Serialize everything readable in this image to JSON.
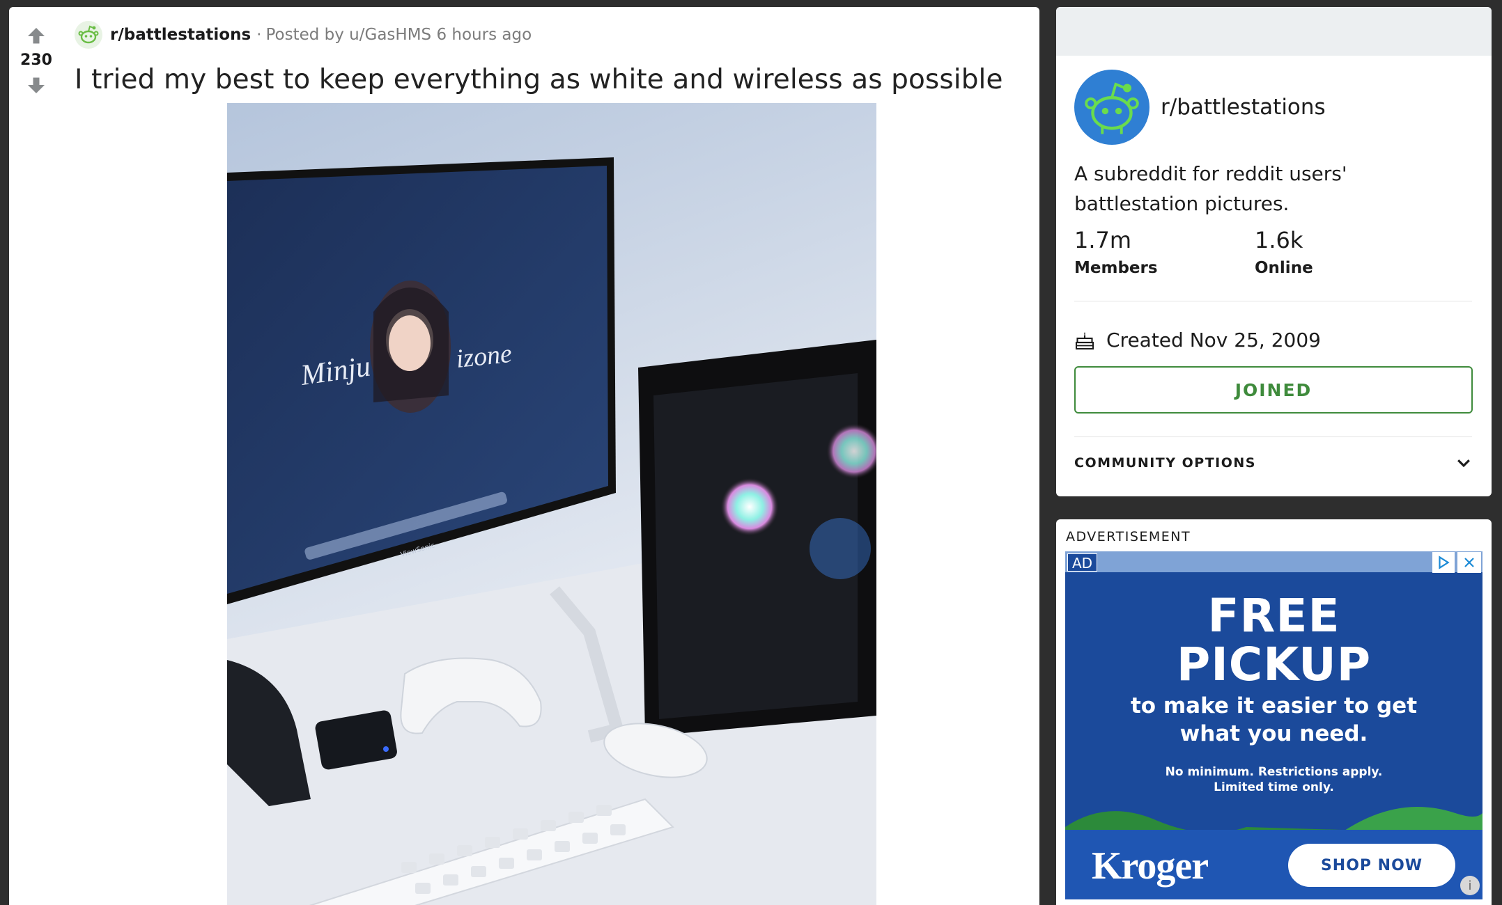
{
  "post": {
    "vote_count": "230",
    "subreddit": "r/battlestations",
    "separator": "·",
    "posted_by": "Posted by u/GasHMS",
    "time_ago": "6 hours ago",
    "title": "I tried my best to keep everything as white and wireless as possible",
    "image": {
      "monitor_wallpaper_left": "Minju",
      "monitor_wallpaper_right": "izone",
      "monitor_brand": "ViewSonic"
    }
  },
  "sidebar": {
    "community_name": "r/battlestations",
    "description": "A subreddit for reddit users' battlestation pictures.",
    "members_count": "1.7m",
    "members_label": "Members",
    "online_count": "1.6k",
    "online_label": "Online",
    "created": "Created Nov 25, 2009",
    "joined_button": "JOINED",
    "community_options": "COMMUNITY OPTIONS"
  },
  "ad": {
    "label": "ADVERTISEMENT",
    "badge": "AD",
    "headline_line1": "FREE",
    "headline_line2": "PICKUP",
    "sub_line1": "to make it easier to get",
    "sub_line2": "what you need.",
    "fine_line1": "No minimum. Restrictions apply.",
    "fine_line2": "Limited time only.",
    "brand": "Kroger",
    "cta": "SHOP NOW",
    "info": "i"
  },
  "colors": {
    "join_green": "#3f8b3c",
    "community_blue": "#2f7fd3",
    "ad_blue": "#1b4a9b",
    "background": "#2e2e2e"
  },
  "icons": [
    "upvote-icon",
    "downvote-icon",
    "snoo-icon",
    "cake-icon",
    "chevron-down-icon",
    "adchoices-icon",
    "close-icon",
    "info-icon"
  ]
}
